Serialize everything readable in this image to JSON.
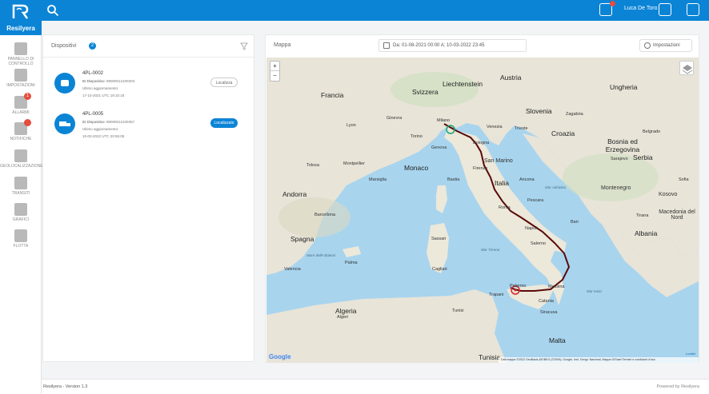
{
  "app": {
    "brand": "Resilyera"
  },
  "topbar": {
    "user_name": "Luca De Toro"
  },
  "sidebar": {
    "items": [
      {
        "label": "Pannello di controllo",
        "icon": "dashboard-icon"
      },
      {
        "label": "Impostazioni",
        "icon": "settings-icon"
      },
      {
        "label": "Allarmi",
        "icon": "alarm-icon",
        "badge": "1"
      },
      {
        "label": "Notifiche",
        "icon": "notification-icon",
        "badge": ""
      },
      {
        "label": "Geolocalizzazione",
        "icon": "geolocation-icon"
      },
      {
        "label": "Transiti",
        "icon": "transit-icon"
      },
      {
        "label": "Grafici",
        "icon": "chart-icon"
      },
      {
        "label": "Flotta",
        "icon": "fleet-icon"
      }
    ]
  },
  "devices": {
    "title": "Dispositivi",
    "count": "2",
    "items": [
      {
        "name": "4PL-0002",
        "id_label": "ID Dispositivo:",
        "id_value": "89000012100303",
        "update_label": "Ultimo aggiornamento:",
        "update_value": "17-10-2021 UTC 19:10:18",
        "button": "Localizza",
        "icon": "phone-icon"
      },
      {
        "name": "4PL-0005",
        "id_label": "ID Dispositivo:",
        "id_value": "89000012100357",
        "update_label": "Ultimo aggiornamento:",
        "update_value": "10-03-2022 UTC 20:55:08",
        "button": "Localizzato",
        "icon": "truck-icon"
      }
    ]
  },
  "map": {
    "title": "Mappa",
    "date_range": "Da: 01-08-2021 00:00  A: 10-03-2022 23:45",
    "settings_label": "Impostazioni",
    "zoom_in": "+",
    "zoom_out": "−",
    "google": "Google",
    "leaflet": "Leaflet",
    "attribution": "Dati mappa ©2022 GeoBasis-DE/BKG (©2009), Google, Inst. Geogr. Nacional, Mappa GISrael   Termini e condizioni d'uso",
    "labels": {
      "countries": [
        "Francia",
        "Svizzera",
        "Liechtenstein",
        "Austria",
        "Ungheria",
        "Slovenia",
        "Croazia",
        "Bosnia ed Erzegovina",
        "Serbia",
        "Monaco",
        "Andorra",
        "Spagna",
        "Italia",
        "San Marino",
        "Montenegro",
        "Kosovo",
        "Macedonia del Nord",
        "Albania",
        "Tunisia",
        "Malta",
        "Algeria"
      ],
      "seas": [
        "Mar Tirreno",
        "Mare delle Baleari",
        "Mar Adriatico",
        "Mar Ionio"
      ],
      "cities": [
        "Milano",
        "Genova",
        "Venezia",
        "Bologna",
        "Firenze",
        "Roma",
        "Napoli",
        "Palermo",
        "Catania",
        "Bari",
        "Lyon",
        "Marsiglia",
        "Barcellona",
        "Zagabria",
        "Belgrado",
        "Sarajevo",
        "Sofia",
        "Tirana",
        "Tolosa",
        "Montpellier",
        "Valencia",
        "Ginevra",
        "Torino",
        "Trieste",
        "Ancona",
        "Pescara",
        "Salerno",
        "Cagliari",
        "Sassari",
        "Bastia",
        "Messina",
        "Siracusa",
        "Trapani",
        "Algeri",
        "Tunisi",
        "Palma"
      ]
    }
  },
  "footer": {
    "version": "Resilyera - Version 1.3",
    "powered": "Powered by Resilyera"
  },
  "colors": {
    "primary": "#0b84d6",
    "alert": "#e74c3c",
    "route": "#5a0a0a"
  }
}
